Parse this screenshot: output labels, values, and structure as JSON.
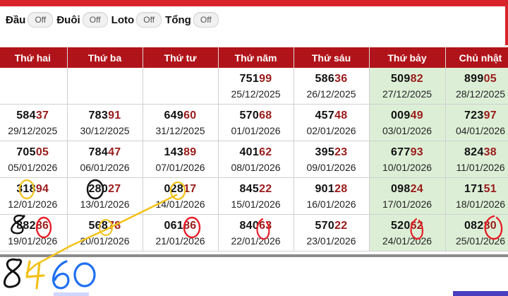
{
  "filters": {
    "items": [
      {
        "label": "Đầu",
        "state": "Off"
      },
      {
        "label": "Đuôi",
        "state": "Off"
      },
      {
        "label": "Loto",
        "state": "Off"
      },
      {
        "label": "Tổng",
        "state": "Off"
      }
    ]
  },
  "table": {
    "headers": [
      "Thứ hai",
      "Thứ ba",
      "Thứ tư",
      "Thứ năm",
      "Thứ sáu",
      "Thứ bảy",
      "Chủ nhật"
    ],
    "rows": [
      [
        {
          "head": "",
          "tail": "",
          "date": ""
        },
        {
          "head": "",
          "tail": "",
          "date": ""
        },
        {
          "head": "",
          "tail": "",
          "date": ""
        },
        {
          "head": "751",
          "tail": "99",
          "date": "25/12/2025"
        },
        {
          "head": "586",
          "tail": "36",
          "date": "26/12/2025"
        },
        {
          "head": "509",
          "tail": "82",
          "date": "27/12/2025"
        },
        {
          "head": "899",
          "tail": "05",
          "date": "28/12/2025"
        }
      ],
      [
        {
          "head": "584",
          "tail": "37",
          "date": "29/12/2025"
        },
        {
          "head": "783",
          "tail": "91",
          "date": "30/12/2025"
        },
        {
          "head": "649",
          "tail": "60",
          "date": "31/12/2025"
        },
        {
          "head": "570",
          "tail": "68",
          "date": "01/01/2026"
        },
        {
          "head": "457",
          "tail": "48",
          "date": "02/01/2026"
        },
        {
          "head": "009",
          "tail": "49",
          "date": "03/01/2026"
        },
        {
          "head": "723",
          "tail": "97",
          "date": "04/01/2026"
        }
      ],
      [
        {
          "head": "705",
          "tail": "05",
          "date": "05/01/2026"
        },
        {
          "head": "784",
          "tail": "47",
          "date": "06/01/2026"
        },
        {
          "head": "143",
          "tail": "89",
          "date": "07/01/2026"
        },
        {
          "head": "401",
          "tail": "62",
          "date": "08/01/2026"
        },
        {
          "head": "395",
          "tail": "23",
          "date": "09/01/2026"
        },
        {
          "head": "677",
          "tail": "93",
          "date": "10/01/2026"
        },
        {
          "head": "824",
          "tail": "38",
          "date": "11/01/2026"
        }
      ],
      [
        {
          "head": "318",
          "tail": "94",
          "date": "12/01/2026"
        },
        {
          "head": "280",
          "tail": "27",
          "date": "13/01/2026"
        },
        {
          "head": "028",
          "tail": "17",
          "date": "14/01/2026"
        },
        {
          "head": "845",
          "tail": "22",
          "date": "15/01/2026"
        },
        {
          "head": "901",
          "tail": "28",
          "date": "16/01/2026"
        },
        {
          "head": "098",
          "tail": "24",
          "date": "17/01/2026"
        },
        {
          "head": "171",
          "tail": "51",
          "date": "18/01/2026"
        }
      ],
      [
        {
          "head": "882",
          "tail": "86",
          "date": "19/01/2026"
        },
        {
          "head": "568",
          "tail": "78",
          "date": "20/01/2026"
        },
        {
          "head": "061",
          "tail": "86",
          "date": "21/01/2026"
        },
        {
          "head": "840",
          "tail": "63",
          "date": "22/01/2026"
        },
        {
          "head": "570",
          "tail": "22",
          "date": "23/01/2026"
        },
        {
          "head": "520",
          "tail": "62",
          "date": "24/01/2026"
        },
        {
          "head": "082",
          "tail": "80",
          "date": "25/01/2026"
        }
      ]
    ]
  },
  "handwriting": {
    "text": "8460"
  },
  "colors": {
    "header_bg": "#b0141a",
    "tail_digits": "#9b1b1b",
    "weekend_cell": "#dcefd6",
    "top_bar": "#d8232a",
    "ink_red": "#e8202a",
    "ink_yellow": "#f3c21a",
    "ink_blue": "#1e6ff0",
    "ink_black": "#111111"
  }
}
